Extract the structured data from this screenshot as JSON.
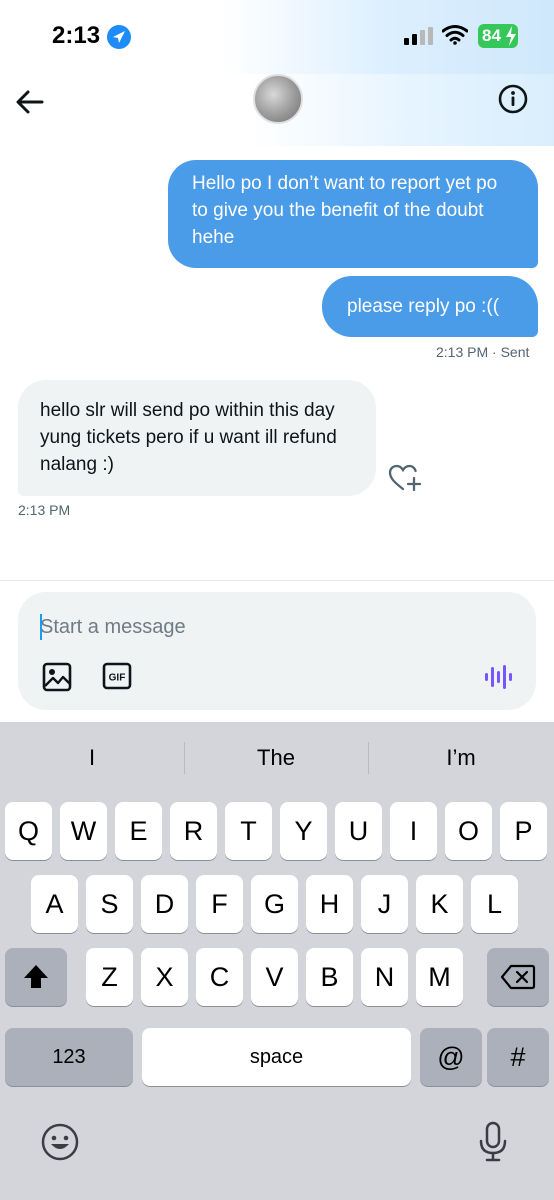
{
  "status_bar": {
    "time": "2:13",
    "battery": "84"
  },
  "conversation": {
    "messages": [
      {
        "from": "me",
        "text": "Hello po I don’t want to report yet po to give you the benefit of the doubt hehe"
      },
      {
        "from": "me",
        "text": "please reply po :(("
      },
      {
        "from": "them",
        "text": "hello slr will send po within this day yung tickets pero if u want ill refund nalang :)"
      }
    ],
    "sent_meta": "2:13 PM · Sent",
    "received_meta": "2:13 PM"
  },
  "composer": {
    "placeholder": "Start a message",
    "gif_label": "GIF"
  },
  "keyboard": {
    "suggestions": [
      "I",
      "The",
      "I’m"
    ],
    "row1": [
      "Q",
      "W",
      "E",
      "R",
      "T",
      "Y",
      "U",
      "I",
      "O",
      "P"
    ],
    "row2": [
      "A",
      "S",
      "D",
      "F",
      "G",
      "H",
      "J",
      "K",
      "L"
    ],
    "row3": [
      "Z",
      "X",
      "C",
      "V",
      "B",
      "N",
      "M"
    ],
    "numbers_label": "123",
    "space_label": "space",
    "at_label": "@",
    "hash_label": "#"
  },
  "colors": {
    "sent_bubble": "#4a9be8",
    "received_bubble": "#eff3f4",
    "accent": "#1d9bf0",
    "voice": "#7856ff"
  },
  "icons": [
    "location-arrow-icon",
    "signal-icon",
    "wifi-icon",
    "battery-icon",
    "back-arrow-icon",
    "info-icon",
    "heart-plus-icon",
    "image-icon",
    "gif-icon",
    "voice-wave-icon",
    "shift-icon",
    "backspace-icon",
    "emoji-icon",
    "microphone-icon"
  ]
}
